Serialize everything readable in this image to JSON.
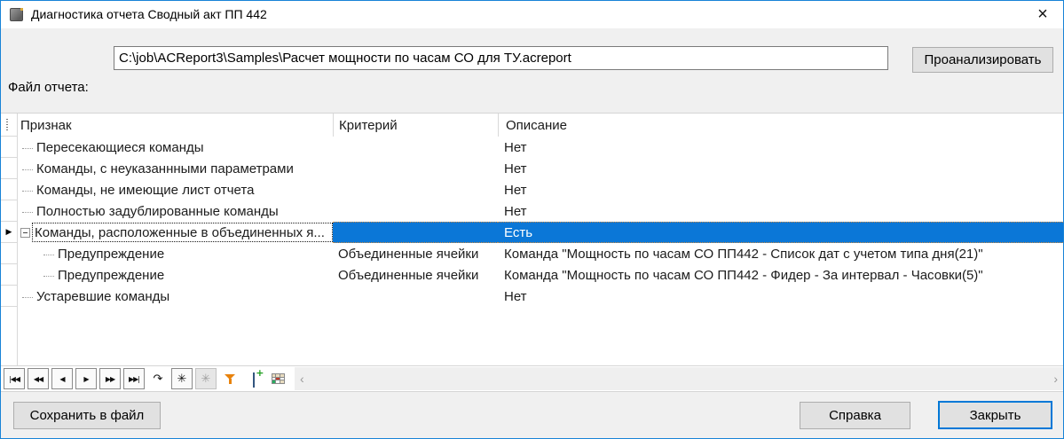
{
  "window": {
    "title": "Диагностика отчета Сводный акт ПП 442",
    "close_glyph": "×"
  },
  "file_section": {
    "label": "Файл отчета:",
    "path": "C:\\job\\ACReport3\\Samples\\Расчет мощности по часам СО для ТУ.acreport",
    "analyze_button": "Проанализировать"
  },
  "grid": {
    "columns": [
      "Признак",
      "Критерий",
      "Описание"
    ],
    "current_row_marker": "▶",
    "rows": [
      {
        "feature": "Пересекающиеся команды",
        "criterion": "",
        "description": "Нет"
      },
      {
        "feature": "Команды, с неуказаннными параметрами",
        "criterion": "",
        "description": "Нет"
      },
      {
        "feature": "Команды, не имеющие лист отчета",
        "criterion": "",
        "description": "Нет"
      },
      {
        "feature": "Полностью задублированные команды",
        "criterion": "",
        "description": "Нет"
      },
      {
        "feature": "Команды, расположенные в объединенных я...",
        "criterion": "",
        "description": "Есть"
      },
      {
        "feature": "Предупреждение",
        "criterion": "Объединенные ячейки",
        "description": "Команда \"Мощность по часам СО ПП442 - Список дат с учетом типа дня(21)\""
      },
      {
        "feature": "Предупреждение",
        "criterion": "Объединенные ячейки",
        "description": "Команда \"Мощность по часам СО ПП442 - Фидер - За интервал - Часовки(5)\""
      },
      {
        "feature": "Устаревшие команды",
        "criterion": "",
        "description": "Нет"
      }
    ]
  },
  "navigator": {
    "buttons": [
      {
        "name": "first",
        "glyph": "|◀◀"
      },
      {
        "name": "prior-page",
        "glyph": "◀◀"
      },
      {
        "name": "prior",
        "glyph": "◀"
      },
      {
        "name": "next",
        "glyph": "▶"
      },
      {
        "name": "next-page",
        "glyph": "▶▶"
      },
      {
        "name": "last",
        "glyph": "▶▶|"
      },
      {
        "name": "refresh",
        "glyph": "↷"
      },
      {
        "name": "expand-all",
        "glyph": "✳"
      },
      {
        "name": "collapse-all",
        "glyph": "✳"
      },
      {
        "name": "filter",
        "glyph": ""
      },
      {
        "name": "save-bookmark",
        "glyph": ""
      },
      {
        "name": "customize",
        "glyph": ""
      }
    ],
    "scroll_left": "‹",
    "scroll_right": "›"
  },
  "footer": {
    "save_button": "Сохранить в файл",
    "help_button": "Справка",
    "close_button": "Закрыть"
  },
  "colors": {
    "accent": "#0078d7",
    "selection_blue": "#0b77d7",
    "selection_focus_dots": "#cf8a3d",
    "filter_orange": "#e8820c"
  }
}
